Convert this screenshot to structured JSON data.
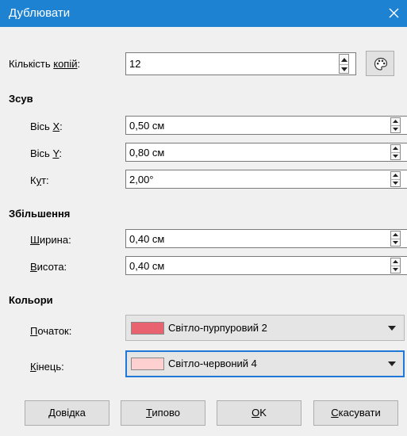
{
  "window": {
    "title": "Дублювати"
  },
  "copies": {
    "label_pre": "Кількість ",
    "label_u": "копій",
    "label_post": ":",
    "value": "12"
  },
  "offset": {
    "heading": "Зсув",
    "x_label_pre": "Вісь ",
    "x_label_u": "X",
    "x_label_post": ":",
    "x_value": "0,50 см",
    "y_label_pre": "Вісь ",
    "y_label_u": "Y",
    "y_label_post": ":",
    "y_value": "0,80 см",
    "angle_label_pre": "К",
    "angle_label_u": "у",
    "angle_label_post": "т:",
    "angle_value": "2,00°"
  },
  "enlargement": {
    "heading": "Збільшення",
    "width_label_u": "Ш",
    "width_label_post": "ирина:",
    "width_value": "0,40 см",
    "height_label_u": "В",
    "height_label_post": "исота:",
    "height_value": "0,40 см"
  },
  "colors": {
    "heading": "Кольори",
    "start_label_u": "П",
    "start_label_post": "очаток:",
    "start_value": "Світло-пурпуровий 2",
    "start_color": "#e8636f",
    "end_label_u": "К",
    "end_label_post": "інець:",
    "end_value": "Світло-червоний 4",
    "end_color": "#ffd0d0"
  },
  "buttons": {
    "help_u": "Д",
    "help_post": "овідка",
    "default_u": "Т",
    "default_post": "ипово",
    "ok_u": "О",
    "ok_post": "K",
    "cancel_u": "С",
    "cancel_post": "касувати"
  },
  "icons": {
    "close": "close-icon",
    "palette": "palette-icon",
    "spin_up": "arrow-up-icon",
    "spin_down": "arrow-down-icon",
    "dropdown": "chevron-down-icon"
  }
}
